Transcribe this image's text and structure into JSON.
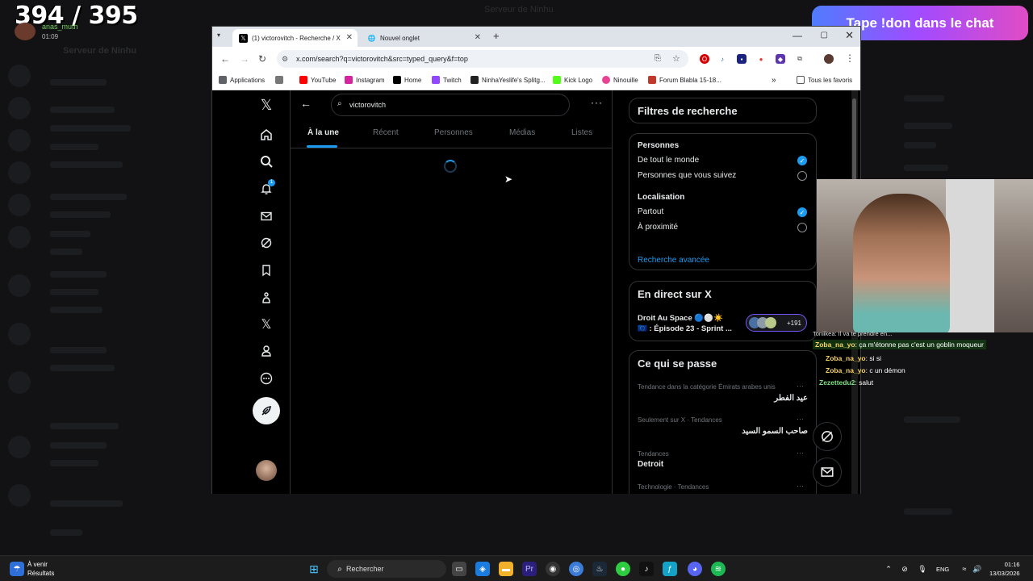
{
  "stream": {
    "viewer_count": "394 / 395",
    "username": "anas_muth",
    "elapsed": "01:09",
    "donation_banner": "Tape !don dans le chat"
  },
  "background_app": {
    "server_name": "Serveur de Ninhu",
    "window_title": "Serveur de Ninhu"
  },
  "browser": {
    "tabs": [
      {
        "label": "(1) victorovitch - Recherche / X",
        "favicon": "x-icon",
        "active": true
      },
      {
        "label": "Nouvel onglet",
        "favicon": "globe-icon",
        "active": false
      }
    ],
    "url": "x.com/search?q=victorovitch&src=typed_query&f=top",
    "bookmarks": [
      {
        "label": "Applications",
        "icon": "apps-icon",
        "color": "#5f6368"
      },
      {
        "label": "YouTube",
        "icon": "youtube-icon",
        "color": "#ff0000"
      },
      {
        "label": "Instagram",
        "icon": "instagram-icon",
        "color": "#d6249f"
      },
      {
        "label": "Home",
        "icon": "x-icon",
        "color": "#000000"
      },
      {
        "label": "Twitch",
        "icon": "twitch-icon",
        "color": "#9146ff"
      },
      {
        "label": "NinhaYeslife's Splitg...",
        "icon": "splits-icon",
        "color": "#222222"
      },
      {
        "label": "Kick Logo",
        "icon": "kick-icon",
        "color": "#53fc18"
      },
      {
        "label": "Ninouille",
        "icon": "ninouille-icon",
        "color": "#e84393"
      },
      {
        "label": "Forum Blabla 15-18...",
        "icon": "jvc-icon",
        "color": "#c0392b"
      }
    ],
    "all_bookmarks_label": "Tous les favoris"
  },
  "x": {
    "search_query": "victorovitch",
    "notification_count": "1",
    "tabs": [
      {
        "label": "À la une",
        "active": true
      },
      {
        "label": "Récent",
        "active": false
      },
      {
        "label": "Personnes",
        "active": false
      },
      {
        "label": "Médias",
        "active": false
      },
      {
        "label": "Listes",
        "active": false
      }
    ],
    "filters": {
      "title": "Filtres de recherche",
      "people_title": "Personnes",
      "people_options": [
        {
          "label": "De tout le monde",
          "selected": true
        },
        {
          "label": "Personnes que vous suivez",
          "selected": false
        }
      ],
      "location_title": "Localisation",
      "location_options": [
        {
          "label": "Partout",
          "selected": true
        },
        {
          "label": "À proximité",
          "selected": false
        }
      ],
      "advanced_link": "Recherche avancée"
    },
    "live": {
      "title": "En direct sur X",
      "space_line1": "Droit Au Space 🔵⚪☀️",
      "space_line2": "🇪🇺 : Épisode 23 - Sprint ...",
      "listeners": "+191"
    },
    "trends": {
      "title": "Ce qui se passe",
      "items": [
        {
          "category": "Tendance dans la catégorie Émirats arabes unis",
          "name": "عيد الفطر"
        },
        {
          "category": "Seulement sur X · Tendances",
          "name": "صاحب السمو السيد"
        },
        {
          "category": "Tendances",
          "name": "Detroit"
        },
        {
          "category": "Technologie · Tendances",
          "name": ""
        }
      ]
    }
  },
  "chat": [
    {
      "user": "",
      "message": "Toniikea: Il va te prendre en...",
      "color": "#ffffff"
    },
    {
      "user": "Zoba_na_yo",
      "message": ": ça m'étonne pas c'est un goblin moqueur",
      "color": "#f6d365"
    },
    {
      "user": "Zoba_na_yo",
      "message": ": si si",
      "color": "#f6d365"
    },
    {
      "user": "Zoba_na_yo",
      "message": ": c un démon",
      "color": "#f6d365"
    },
    {
      "user": "Zezettedu2",
      "message": ": salut",
      "color": "#7ee081"
    }
  ],
  "taskbar": {
    "weather_title": "À venir",
    "weather_sub": "Résultats",
    "search_placeholder": "Rechercher",
    "lang": "ENG",
    "time": "01:16",
    "date": "13/03/2026"
  }
}
